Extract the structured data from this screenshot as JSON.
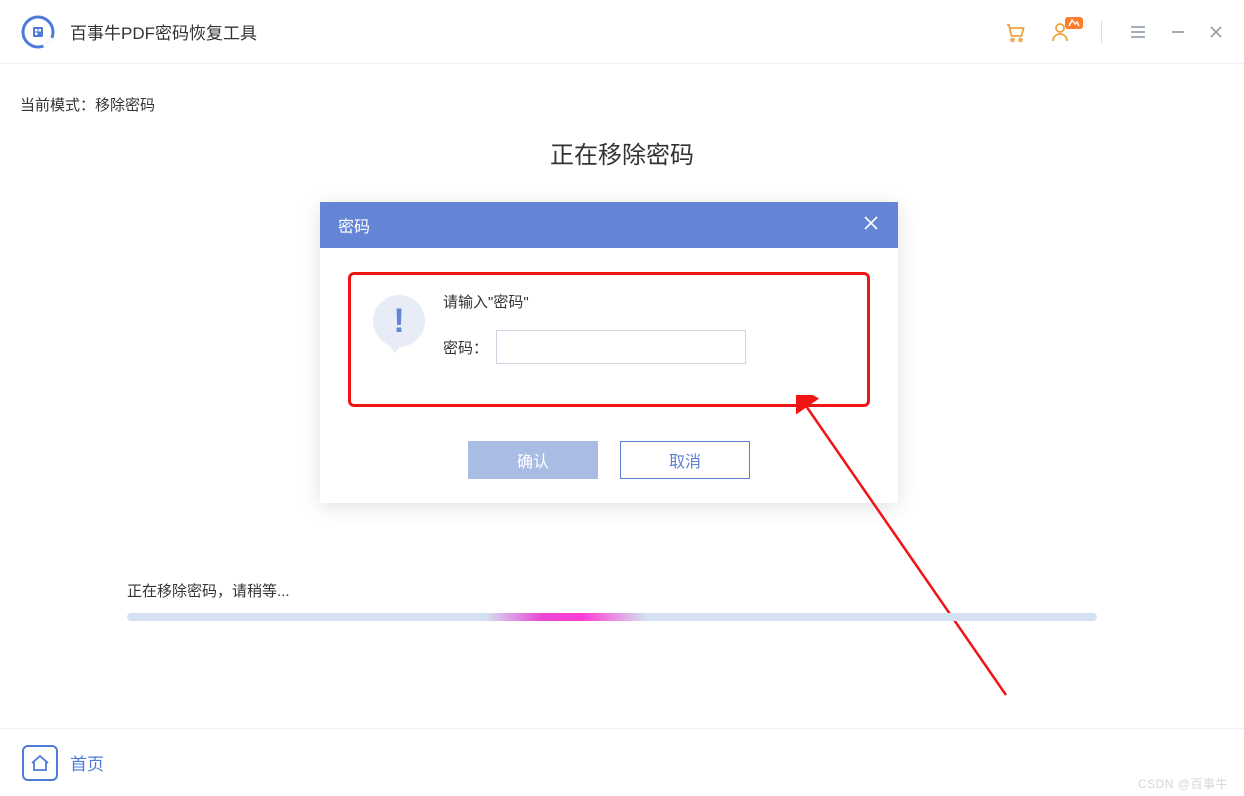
{
  "app": {
    "title": "百事牛PDF密码恢复工具"
  },
  "header": {
    "icons": {
      "cart": "cart-icon",
      "user": "user-icon",
      "menu": "menu-icon",
      "minimize": "minimize-icon",
      "close": "close-icon"
    }
  },
  "main": {
    "mode_label": "当前模式：",
    "mode_value": "移除密码",
    "title": "正在移除密码",
    "progress_text": "正在移除密码，请稍等..."
  },
  "dialog": {
    "title": "密码",
    "prompt": "请输入\"密码\"",
    "password_label": "密码：",
    "confirm": "确认",
    "cancel": "取消"
  },
  "footer": {
    "home": "首页"
  },
  "watermark": "CSDN @百事牛",
  "colors": {
    "accent": "#6485d6",
    "highlight": "#ef1515",
    "link": "#5b7fd1"
  }
}
